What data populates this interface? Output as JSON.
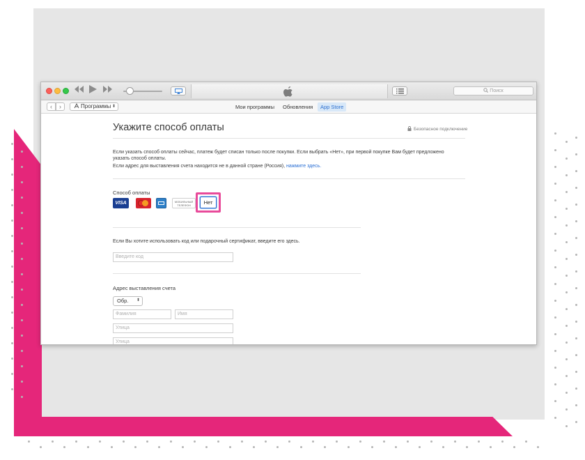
{
  "window": {
    "search_placeholder": "Поиск"
  },
  "nav": {
    "media_kind": "Программы",
    "tabs": [
      {
        "label": "Мои программы"
      },
      {
        "label": "Обновления"
      },
      {
        "label": "App Store"
      }
    ]
  },
  "page": {
    "title": "Укажите способ оплаты",
    "secure_label": "Безопасное подключение",
    "intro_line1": "Если указать способ оплаты сейчас, платеж будет списан только после покупки. Если выбрать «Нет», при первой покупке Вам будет предложено",
    "intro_line2": "указать способ оплаты.",
    "country_text": "Если адрес для выставления счета находится не в данной стране (Россия),",
    "country_link": "нажмите здесь."
  },
  "payment": {
    "label": "Способ оплаты",
    "visa_label": "VISA",
    "mobile_label_1": "МОБИЛЬНЫЙ",
    "mobile_label_2": "ТЕЛЕФОН",
    "none_label": "Нет"
  },
  "gift": {
    "label": "Если Вы хотите использовать код или подарочный сертификат, введите его здесь.",
    "code_placeholder": "Введите код"
  },
  "billing": {
    "label": "Адрес выставления счета",
    "salutation": "Обр.",
    "last_name_placeholder": "Фамилия",
    "first_name_placeholder": "Имя",
    "street_placeholder": "Улица",
    "street2_placeholder": "Улица"
  },
  "colors": {
    "accent": "#2a6fd4",
    "highlight": "#e84a9a",
    "decor_pink": "#e5267a"
  }
}
